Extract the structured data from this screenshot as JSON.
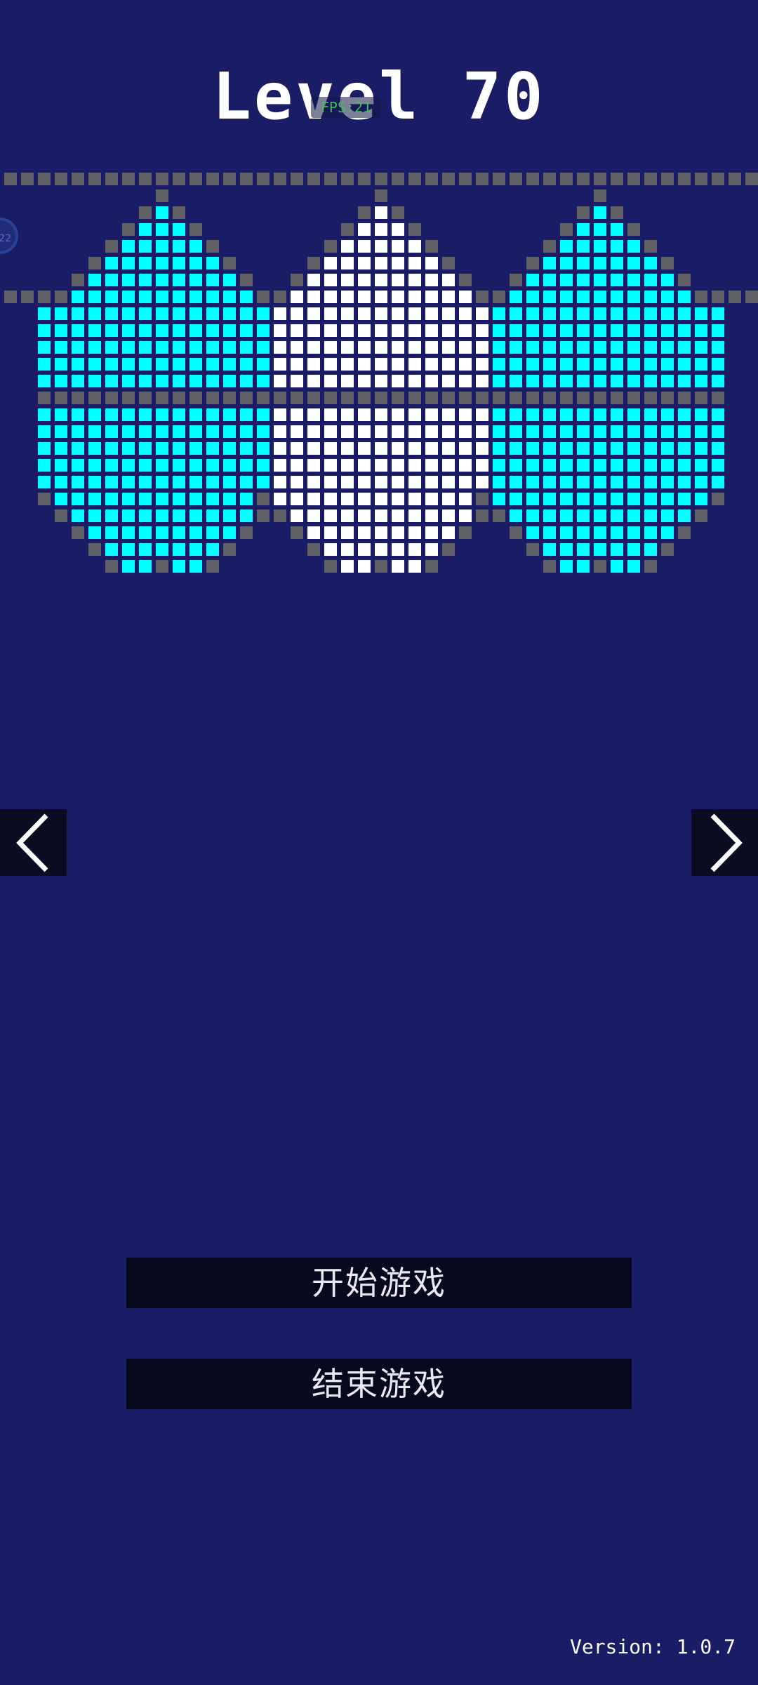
{
  "level_title": "Level 70",
  "fps_label": "FPS:21",
  "side_badge_text": "22",
  "colors": {
    "background": "#1a1c66",
    "wall": "#5f5f66",
    "cyan": "#00ffff",
    "white": "#ffffff",
    "button": "#070a1e"
  },
  "nav": {
    "prev_icon": "chevron-left-icon",
    "next_icon": "chevron-right-icon"
  },
  "menu": {
    "start_label": "开始游戏",
    "quit_label": "结束游戏"
  },
  "version_text": "Version: 1.0.7"
}
